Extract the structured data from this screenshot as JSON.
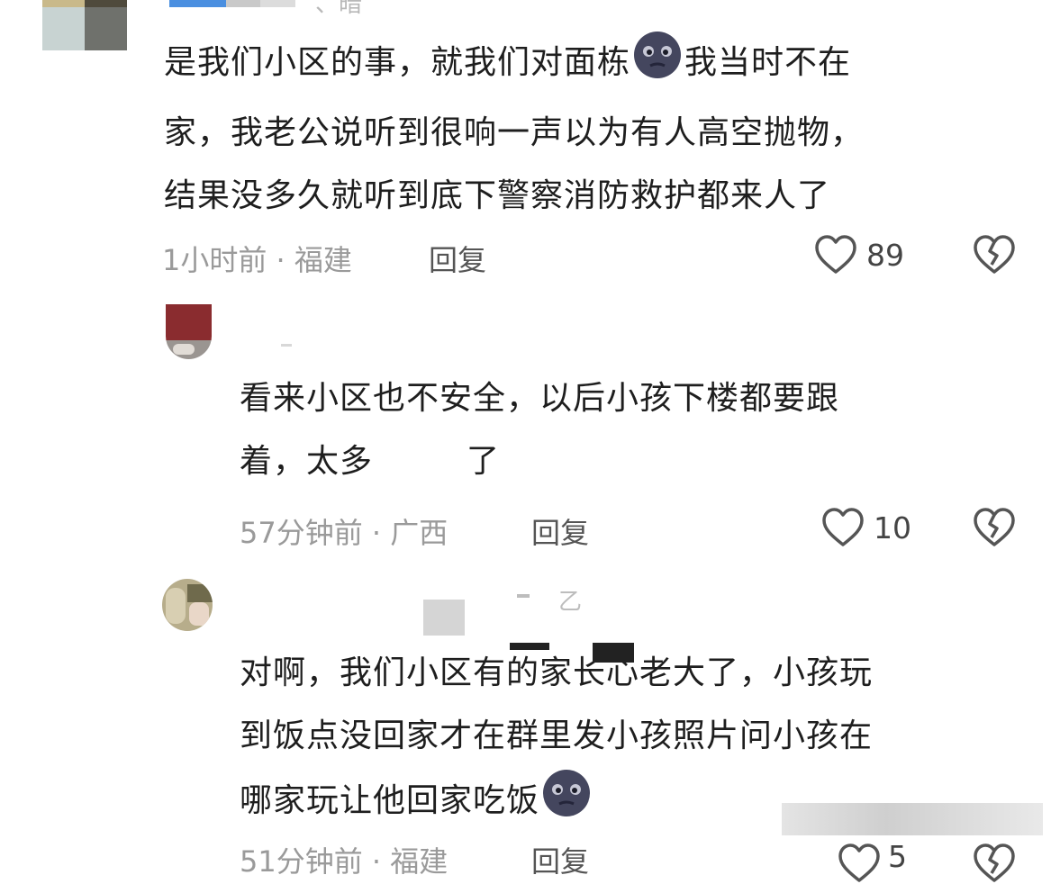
{
  "colors": {
    "text": "#1e1e1e",
    "meta": "#9a9a9a",
    "reply": "#555555",
    "icon": "#555555"
  },
  "comments": [
    {
      "name_partial": "、暗",
      "lines": [
        "是我们小区的事，就我们对面栋",
        "我当时不在",
        "家，我老公说听到很响一声以为有人高空抛物，",
        "结果没多久就听到底下警察消防救护都来人了"
      ],
      "emoji": "new-moon-face",
      "meta": "1小时前 · 福建",
      "reply": "回复",
      "likes": "89"
    },
    {
      "lines": [
        "看来小区也不安全，以后小孩下楼都要跟",
        "着，太多",
        "了"
      ],
      "meta": "57分钟前 · 广西",
      "reply": "回复",
      "likes": "10"
    },
    {
      "name_partial": "乙",
      "lines": [
        "对啊，我们小区有的家长心老大了，小孩玩",
        "到饭点没回家才在群里发小孩照片问小孩在",
        "哪家玩让他回家吃饭"
      ],
      "emoji": "new-moon-face",
      "meta": "51分钟前 · 福建",
      "reply": "回复",
      "likes": "5"
    }
  ]
}
